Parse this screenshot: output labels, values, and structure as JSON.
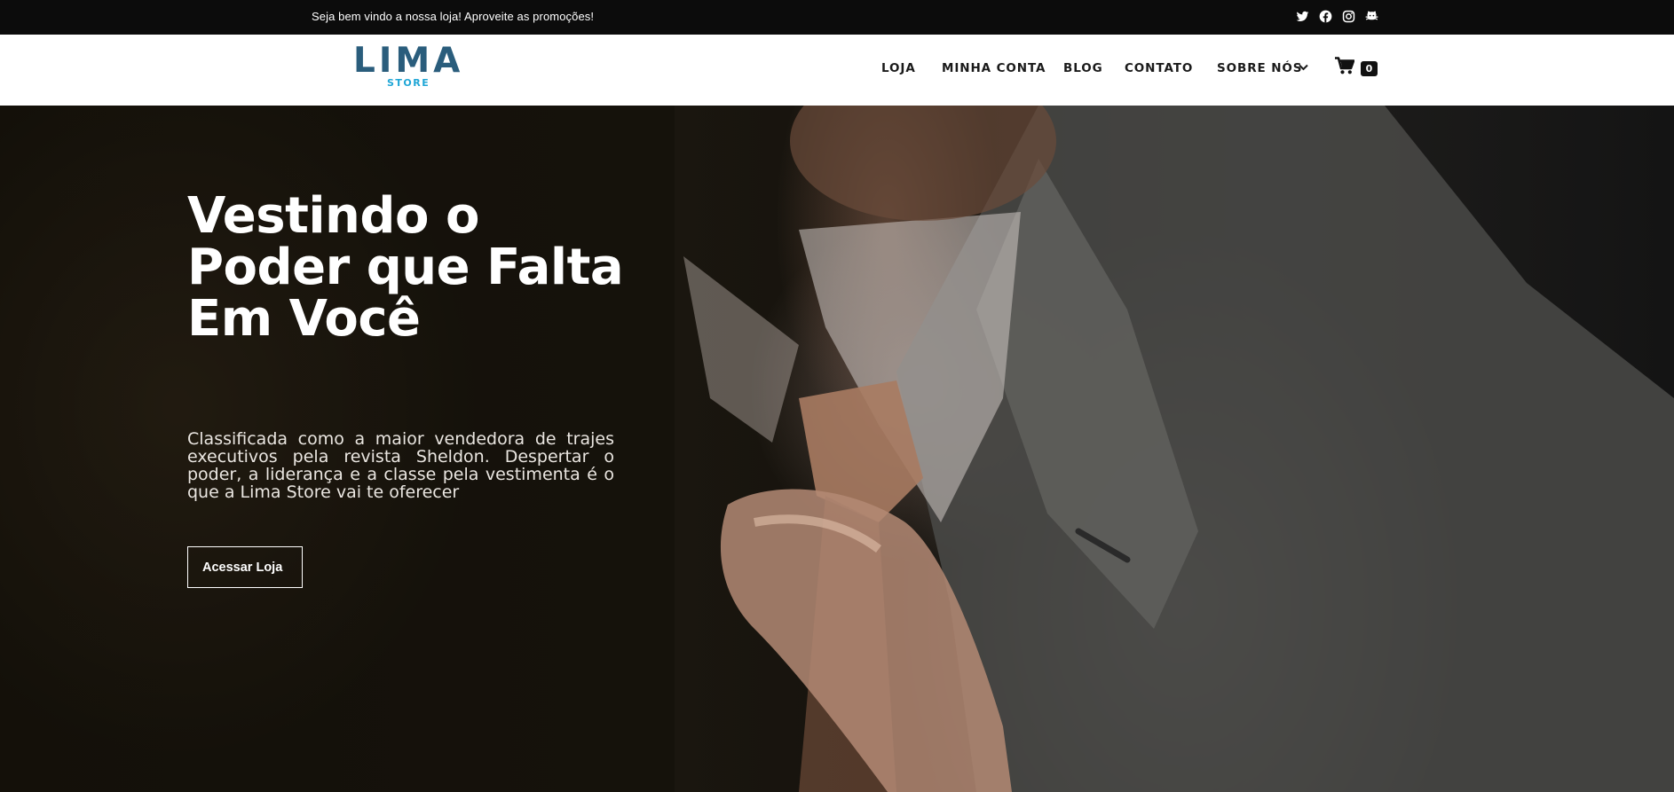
{
  "topbar": {
    "message": "Seja bem vindo a nossa loja! Aproveite as promoções!",
    "social_icons": [
      "twitter-icon",
      "facebook-icon",
      "instagram-icon",
      "github-icon"
    ]
  },
  "header": {
    "logo": {
      "main": "LIMA",
      "sub": "STORE"
    },
    "nav": [
      {
        "label": "LOJA"
      },
      {
        "label": "MINHA CONTA"
      },
      {
        "label": "BLOG"
      },
      {
        "label": "CONTATO"
      },
      {
        "label": "SOBRE NÓS",
        "has_dropdown": true
      }
    ],
    "cart_count": "0"
  },
  "hero": {
    "title": "Vestindo o Poder que Falta Em Você",
    "text": "Classificada como a maior vendedora de trajes executivos pela revista Sheldon. Despertar o poder, a liderança e a classe pela vestimenta é o que a Lima Store vai te oferecer",
    "button_label": "Acessar Loja"
  },
  "colors": {
    "topbar_bg": "#0c0c0c",
    "logo_main": "#2a5d7c",
    "logo_sub": "#1fa6d6",
    "nav_text": "#1a1a1a"
  }
}
